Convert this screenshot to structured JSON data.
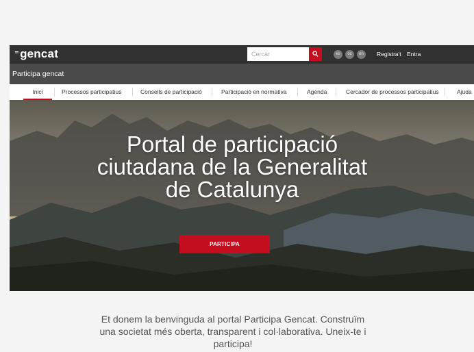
{
  "header": {
    "logo_text": "gencat",
    "search": {
      "placeholder": "Cercar"
    },
    "languages": [
      "es",
      "oc",
      "en"
    ],
    "register_label": "Registra't",
    "login_label": "Entra"
  },
  "subheader": {
    "title": "Participa gencat"
  },
  "nav": {
    "items": [
      {
        "label": "Inici",
        "active": true
      },
      {
        "label": "Processos participatius"
      },
      {
        "label": "Consells de participació"
      },
      {
        "label": "Participació en normativa"
      },
      {
        "label": "Agenda"
      },
      {
        "label": "Cercador de processos participatius"
      },
      {
        "label": "Ajuda"
      }
    ]
  },
  "hero": {
    "title_lines": [
      "Portal de participació",
      "ciutadana de la Generalitat",
      "de Catalunya"
    ],
    "cta_label": "PARTICIPA"
  },
  "welcome": {
    "lines": [
      "Et donem la benvinguda al portal Participa Gencat. Construïm",
      "una societat més oberta, transparent i col·laborativa. Uneix-te i",
      "participa!"
    ]
  },
  "colors": {
    "accent": "#c40d1e",
    "topbar": "#313131",
    "subbar": "#4a4a4a"
  }
}
